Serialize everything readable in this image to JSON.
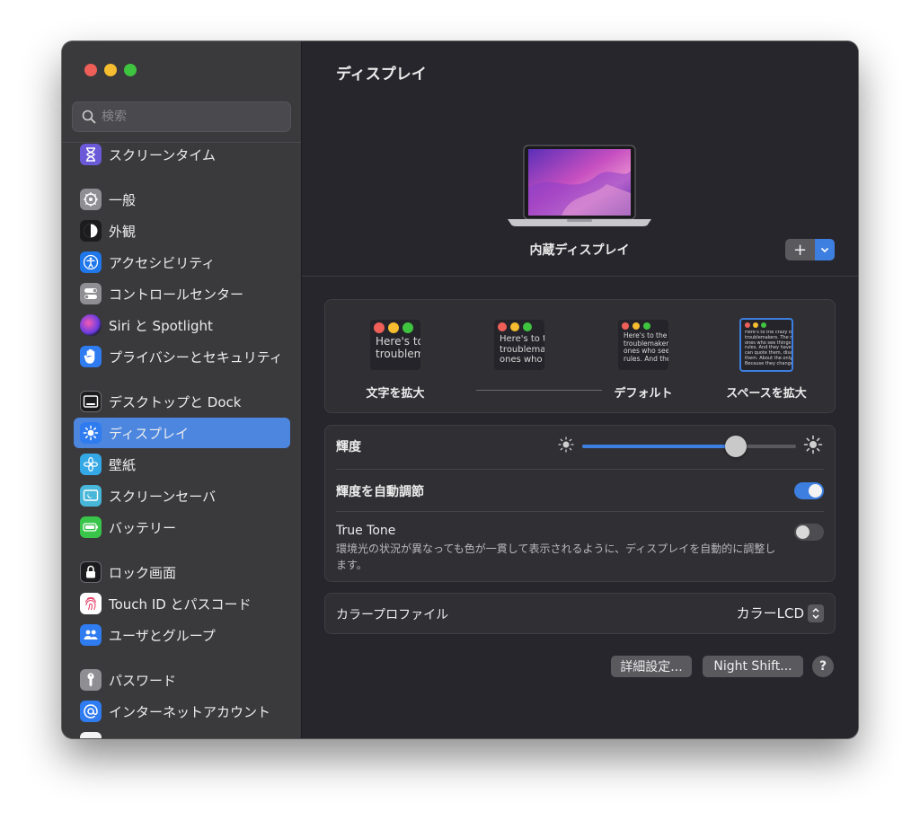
{
  "window": {
    "controls": {
      "close": "#ee5f58",
      "minimize": "#f5bd2f",
      "zoom": "#3fc43f"
    }
  },
  "sidebar": {
    "search_placeholder": "検索",
    "items": [
      {
        "label": "スクリーンタイム",
        "icon": "hourglass-icon",
        "color": "#6a5ad8"
      },
      {
        "label": "一般",
        "icon": "gear-icon",
        "color": "#8e8e93"
      },
      {
        "label": "外観",
        "icon": "appearance-icon",
        "color": "#1c1c1e"
      },
      {
        "label": "アクセシビリティ",
        "icon": "accessibility-icon",
        "color": "#1f77ea"
      },
      {
        "label": "コントロールセンター",
        "icon": "control-center-icon",
        "color": "#8e8e93"
      },
      {
        "label": "Siri と Spotlight",
        "icon": "siri-icon",
        "color": "#b64fd6"
      },
      {
        "label": "プライバシーとセキュリティ",
        "icon": "hand-icon",
        "color": "#2f7bf0"
      },
      {
        "label": "デスクトップと Dock",
        "icon": "dock-icon",
        "color": "#1c1c1e"
      },
      {
        "label": "ディスプレイ",
        "icon": "sun-icon",
        "color": "#2f7bf0",
        "active": true
      },
      {
        "label": "壁紙",
        "icon": "flower-icon",
        "color": "#35a9e6"
      },
      {
        "label": "スクリーンセーバ",
        "icon": "screensaver-icon",
        "color": "#47b6d8"
      },
      {
        "label": "バッテリー",
        "icon": "battery-icon",
        "color": "#39c44a"
      },
      {
        "label": "ロック画面",
        "icon": "lock-icon",
        "color": "#1c1c1e"
      },
      {
        "label": "Touch ID とパスコード",
        "icon": "fingerprint-icon",
        "color": "#ffffff"
      },
      {
        "label": "ユーザとグループ",
        "icon": "users-icon",
        "color": "#2f7bf0"
      },
      {
        "label": "パスワード",
        "icon": "key-icon",
        "color": "#8e8e93"
      },
      {
        "label": "インターネットアカウント",
        "icon": "at-icon",
        "color": "#2f7bf0"
      }
    ]
  },
  "main": {
    "title": "ディスプレイ",
    "display_name": "内蔵ディスプレイ",
    "add_button": "+",
    "resolution": {
      "options": [
        {
          "label": "文字を拡大",
          "preview": "Here's to\ntroublem"
        },
        {
          "label": "",
          "preview": "Here's to t\ntroublema\nones who"
        },
        {
          "label": "デフォルト",
          "preview": "Here's to the cr\ntroublemakers.\nones who see t\nrules. And they"
        },
        {
          "label": "スペースを拡大",
          "preview": "Here's to the crazy one\ntroublemakers. The rou\nones who see things diff\nrules. And they have no\ncan quote them, disagr\nthem. About the only th\nBecause they change th"
        }
      ]
    },
    "brightness": {
      "label": "輝度",
      "value": 0.72
    },
    "auto_brightness": {
      "label": "輝度を自動調節",
      "on": true
    },
    "true_tone": {
      "label": "True Tone",
      "description": "環境光の状況が異なっても色が一貫して表示されるように、ディスプレイを自動的に調整します。",
      "on": false
    },
    "color_profile": {
      "label": "カラープロファイル",
      "value": "カラーLCD"
    },
    "buttons": {
      "advanced": "詳細設定...",
      "night_shift": "Night Shift...",
      "help": "?"
    }
  }
}
